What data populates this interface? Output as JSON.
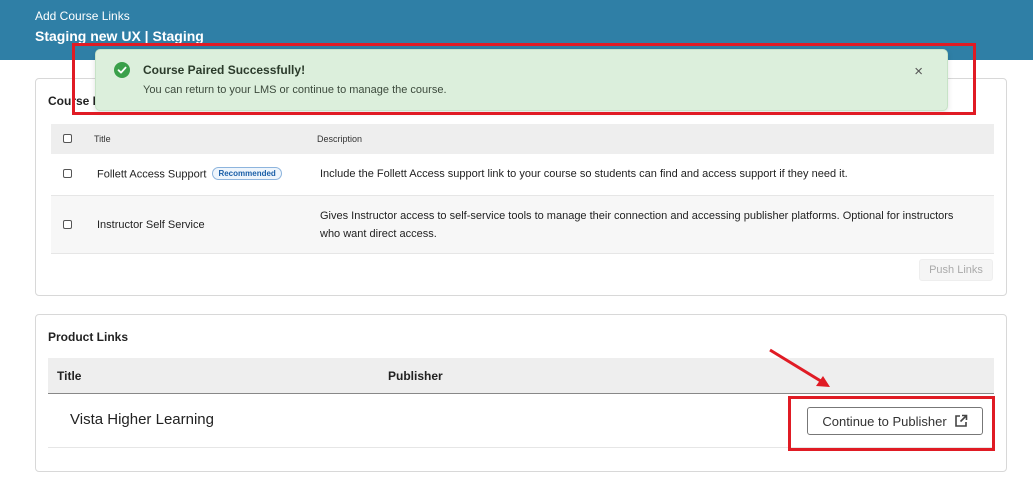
{
  "header": {
    "subtitle": "Add Course Links",
    "title": "Staging new UX | Staging"
  },
  "toast": {
    "title": "Course Paired Successfully!",
    "message": "You can return to your LMS or continue to manage the course.",
    "close_label": "×"
  },
  "course_links": {
    "title": "Course Links",
    "columns": [
      "Title",
      "Description"
    ],
    "rows": [
      {
        "title": "Follett Access Support",
        "badge": "Recommended",
        "description": "Include the Follett Access support link to your course so students can find and access support if they need it."
      },
      {
        "title": "Instructor Self Service",
        "description": "Gives Instructor access to self-service tools to manage their connection and accessing publisher platforms. Optional for instructors who want direct access."
      }
    ],
    "push_label": "Push Links"
  },
  "product_links": {
    "title": "Product Links",
    "columns": [
      "Title",
      "Publisher"
    ],
    "rows": [
      {
        "title": "Vista Higher Learning",
        "publisher": "",
        "action_label": "Continue to Publisher"
      }
    ]
  },
  "colors": {
    "header_bg": "#2f7fa6",
    "toast_bg": "#dcefdc",
    "success_green": "#3aa04a",
    "annotation_red": "#e01b24"
  },
  "icons": {
    "toast": "check-circle-icon",
    "close": "close-icon",
    "external": "external-link-icon"
  }
}
